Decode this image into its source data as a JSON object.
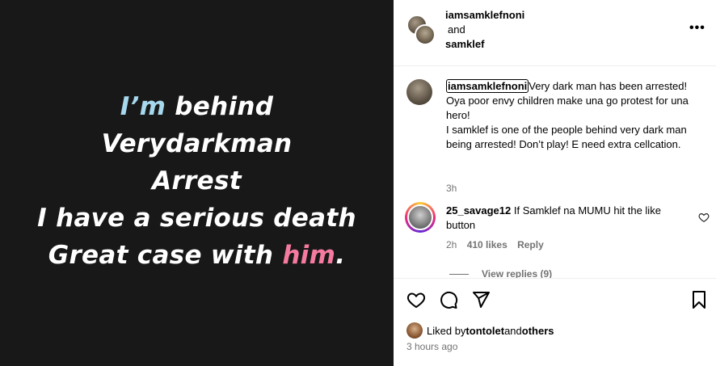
{
  "media": {
    "line1_a": "I’m",
    "line1_b": " behind",
    "line2": "Verydarkman",
    "line3": "Arrest",
    "line4": "I have a serious death",
    "line5_a": "Great case with ",
    "line5_b": "him",
    "line5_c": "."
  },
  "header": {
    "user1": "iamsamklefnoni",
    "and": "and",
    "user2": "samklef",
    "more_icon": "more-options-icon"
  },
  "caption": {
    "username": "iamsamklefnoni",
    "text": "Very dark man has been arrested! Oya poor envy children make una go protest for una hero!",
    "text2": "I samklef is one of the people behind very dark man being arrested! Don’t play! E need extra cellcation.",
    "time": "3h"
  },
  "comment": {
    "username": "25_savage12",
    "text": " If Samklef na MUMU hit the like button",
    "time": "2h",
    "likes": "410 likes",
    "reply": "Reply"
  },
  "view_replies": "View replies (9)",
  "likes": {
    "liked_by": "Liked by ",
    "user": "tontolet",
    "and": " and ",
    "others": "others"
  },
  "time_ago": "3 hours ago",
  "colors": {
    "highlight_blue": "#a6d8ee",
    "highlight_pink": "#f57aa0",
    "media_bg": "#181818"
  }
}
